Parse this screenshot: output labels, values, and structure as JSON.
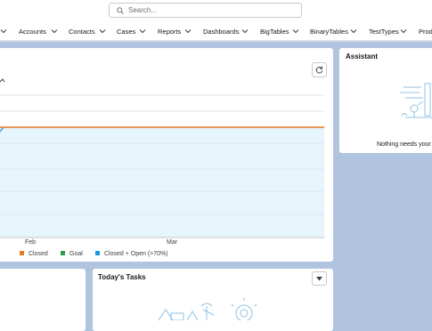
{
  "search": {
    "placeholder": "Search..."
  },
  "nav": {
    "items": [
      "Accounts",
      "Contacts",
      "Cases",
      "Reports",
      "Dashboards",
      "BigTables",
      "BinaryTables",
      "TestTypes",
      "Prod"
    ]
  },
  "chart_data": {
    "type": "area",
    "x_ticks": [
      "Feb",
      "Mar"
    ],
    "series": [
      {
        "name": "Closed",
        "color": "#e37b23",
        "values": []
      },
      {
        "name": "Goal",
        "color": "#2a9d4a",
        "values": []
      },
      {
        "name": "Closed + Open (>70%)",
        "color": "#1b96dc",
        "values": []
      }
    ],
    "grid": true,
    "legend": "bottom-left"
  },
  "assistant": {
    "title": "Assistant",
    "message": "Nothing needs your"
  },
  "tasks": {
    "title": "Today's Tasks"
  },
  "colors": {
    "background": "#b0c4df",
    "card": "#ffffff",
    "closed_line": "#e37b23",
    "area_fill": "#e6f4fc"
  },
  "icons": {
    "search": "search-icon",
    "refresh": "refresh-icon",
    "dropdown": "chevron-down-icon"
  }
}
